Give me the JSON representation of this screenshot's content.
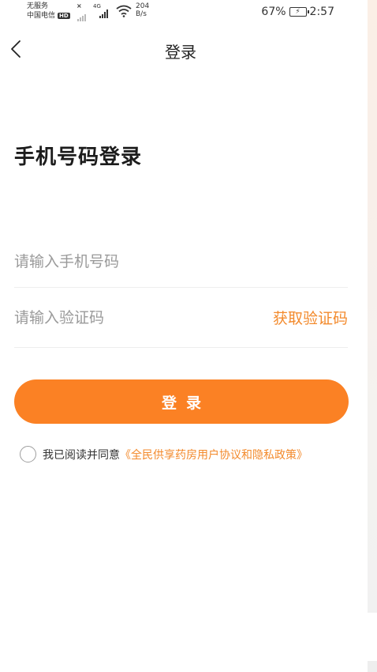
{
  "status_bar": {
    "no_service": "无服务",
    "carrier": "中国电信",
    "hd": "HD",
    "network_4g": "4G",
    "speed_value": "204",
    "speed_unit": "B/s",
    "battery": "67%",
    "time": "2:57"
  },
  "nav": {
    "title": "登录"
  },
  "page": {
    "heading": "手机号码登录"
  },
  "form": {
    "phone_placeholder": "请输入手机号码",
    "phone_value": "",
    "code_placeholder": "请输入验证码",
    "code_value": "",
    "get_code_label": "获取验证码",
    "login_label": "登录"
  },
  "agreement": {
    "checked": false,
    "text": "我已阅读并同意",
    "link": "《全民供享药房用户协议和隐私政策》"
  },
  "colors": {
    "accent": "#fb8124",
    "link": "#f38a2c",
    "placeholder": "#9a9a9a"
  }
}
